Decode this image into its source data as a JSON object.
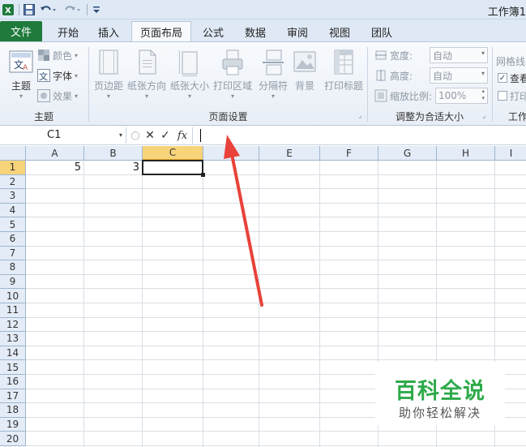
{
  "window": {
    "title": "工作簿1"
  },
  "tabs": [
    "文件",
    "开始",
    "插入",
    "页面布局",
    "公式",
    "数据",
    "审阅",
    "视图",
    "团队"
  ],
  "ribbon": {
    "theme_group": {
      "label": "主题",
      "theme_btn": "主题",
      "colors": "颜色",
      "fonts": "字体",
      "effects": "效果"
    },
    "page_setup_group": {
      "label": "页面设置",
      "margins": "页边距",
      "orientation": "纸张方向",
      "size": "纸张大小",
      "print_area": "打印区域",
      "breaks": "分隔符",
      "background": "背景",
      "print_titles": "打印标题"
    },
    "scale_group": {
      "label": "调整为合适大小",
      "width_label": "宽度:",
      "width_value": "自动",
      "height_label": "高度:",
      "height_value": "自动",
      "scale_label": "缩放比例:",
      "scale_value": "100%"
    },
    "sheet_options_group": {
      "label": "工作",
      "gridlines": "网格线",
      "view": "查看",
      "print": "打印"
    }
  },
  "formula_bar": {
    "name_box": "C1",
    "content": "",
    "fx": "fx"
  },
  "grid": {
    "columns": [
      "A",
      "B",
      "C",
      "D",
      "E",
      "F",
      "G",
      "H",
      "I"
    ],
    "rows": [
      "1",
      "2",
      "3",
      "4",
      "5",
      "6",
      "7",
      "8",
      "9",
      "10",
      "11",
      "12",
      "13",
      "14",
      "15",
      "16",
      "17",
      "18",
      "19",
      "20"
    ],
    "cells": {
      "A1": "5",
      "B1": "3"
    },
    "active_cell": "C1"
  },
  "watermark": {
    "title": "百科全说",
    "subtitle": "助你轻松解决"
  },
  "colors": {
    "file_tab": "#1f7a3b",
    "selection_header": "#f7d37a",
    "arrow": "#e8423a",
    "watermark_green": "#2eaa4a"
  }
}
